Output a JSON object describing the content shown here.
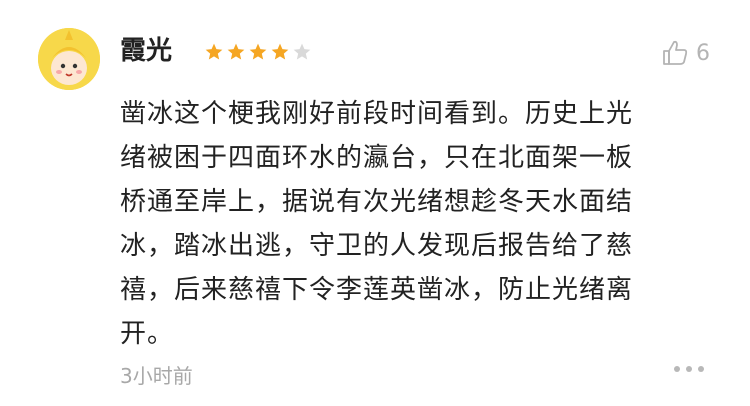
{
  "comment": {
    "avatar_icon": "cartoon-duck-avatar",
    "username": "霞光",
    "rating": 4,
    "rating_max": 5,
    "star_color": "#f5a623",
    "star_empty_color": "#d9d9d9",
    "like_icon": "thumbs-up-icon",
    "like_count": "6",
    "content": "凿冰这个梗我刚好前段时间看到。历史上光\n绪被困于四面环水的瀛台，只在北面架一板\n桥通至岸上，据说有次光绪想趁冬天水面结\n冰，踏冰出逃，守卫的人发现后报告给了慈\n禧，后来慈禧下令李莲英凿冰，防止光绪离\n开。",
    "time": "3小时前",
    "more_icon": "more-dots-icon"
  }
}
